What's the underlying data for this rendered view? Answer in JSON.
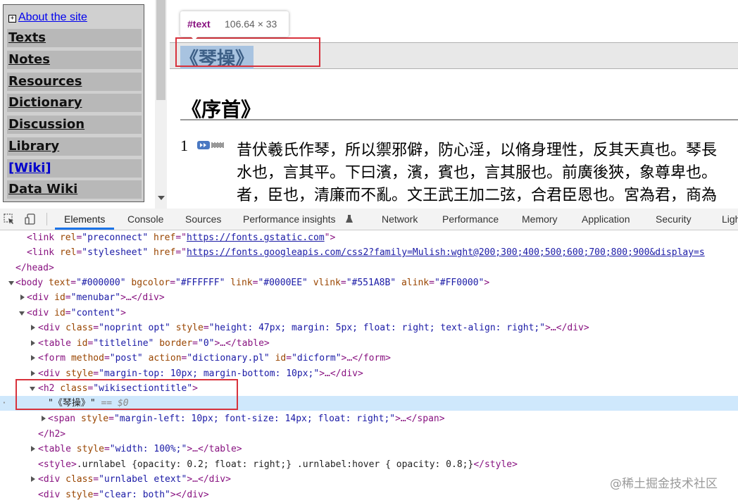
{
  "sidebar": {
    "about_plus": "+",
    "about_link": "About the site",
    "items": [
      "Texts",
      "Notes",
      "Resources",
      "Dictionary",
      "Discussion",
      "Library",
      "[Wiki]",
      "Data Wiki"
    ]
  },
  "tooltip": {
    "tag": "#text",
    "dims": "106.64 × 33"
  },
  "page": {
    "section_title": "《琴操》",
    "preface_heading": "《序首》",
    "verse_number": "1",
    "verse_lines": [
      "昔伏羲氏作琴，所以禦邪僻，防心淫，以脩身理性，反其天真也。琴長",
      "水也，言其平。下曰濱，濱，賓也，言其服也。前廣後狹，象尊卑也。",
      "者，臣也，清廉而不亂。文王武王加二弦，合君臣恩也。宮為君，商為"
    ]
  },
  "devtools": {
    "tabs": [
      "Elements",
      "Console",
      "Sources",
      "Performance insights",
      "Network",
      "Performance",
      "Memory",
      "Application",
      "Security",
      "Ligh"
    ],
    "active_tab": "Elements",
    "dom": {
      "l1": {
        "open": "<link ",
        "a1": "rel",
        "v1": "\"preconnect\"",
        "a2": "href",
        "url": "https://fonts.gstatic.com",
        "close": ">"
      },
      "l2": {
        "open": "<link ",
        "a1": "rel",
        "v1": "\"stylesheet\"",
        "a2": "href",
        "url": "https://fonts.googleapis.com/css2?family=Mulish:wght@200;300;400;500;600;700;800;900&display=s"
      },
      "l3": "</head>",
      "l4": {
        "open": "<body ",
        "a1": "text",
        "v1": "\"#000000\"",
        "a2": "bgcolor",
        "v2": "\"#FFFFFF\"",
        "a3": "link",
        "v3": "\"#0000EE\"",
        "a4": "vlink",
        "v4": "\"#551A8B\"",
        "a5": "alink",
        "v5": "\"#FF0000\"",
        "close": ">"
      },
      "l5": {
        "open": "<div ",
        "a1": "id",
        "v1": "\"menubar\"",
        "mid": ">…",
        "close": "</div>"
      },
      "l6": {
        "open": "<div ",
        "a1": "id",
        "v1": "\"content\"",
        "close": ">"
      },
      "l7": {
        "open": "<div ",
        "a1": "class",
        "v1": "\"noprint opt\"",
        "a2": "style",
        "v2": "\"height: 47px; margin: 5px; float: right; text-align: right;\"",
        "mid": ">…",
        "close": "</div>"
      },
      "l8": {
        "open": "<table ",
        "a1": "id",
        "v1": "\"titleline\"",
        "a2": "border",
        "v2": "\"0\"",
        "mid": ">…",
        "close": "</table>"
      },
      "l9": {
        "open": "<form ",
        "a1": "method",
        "v1": "\"post\"",
        "a2": "action",
        "v2": "\"dictionary.pl\"",
        "a3": "id",
        "v3": "\"dicform\"",
        "mid": ">…",
        "close": "</form>"
      },
      "l10": {
        "open": "<div ",
        "a1": "style",
        "v1": "\"margin-top: 10px; margin-bottom: 10px;\"",
        "mid": ">…",
        "close": "</div>"
      },
      "l11": {
        "open": "<h2 ",
        "a1": "class",
        "v1": "\"wikisectiontitle\"",
        "close": ">"
      },
      "l12": {
        "text": "\"《琴操》\"",
        "eq": " == $0"
      },
      "l13": {
        "open": "<span ",
        "a1": "style",
        "v1": "\"margin-left: 10px; font-size: 14px; float: right;\"",
        "mid": ">…",
        "close": "</span>"
      },
      "l14": "</h2>",
      "l15": {
        "open": "<table ",
        "a1": "style",
        "v1": "\"width: 100%;\"",
        "mid": ">…",
        "close": "</table>"
      },
      "l16": {
        "open": "<style>",
        "css": ".urnlabel {opacity: 0.2; float: right;} .urnlabel:hover { opacity: 0.8;}",
        "close": "</style>"
      },
      "l17": {
        "open": "<div ",
        "a1": "class",
        "v1": "\"urnlabel etext\"",
        "mid": ">…",
        "close": "</div>"
      },
      "l18": {
        "open": "<div ",
        "a1": "style",
        "v1": "\"clear: both\"",
        "mid": ">",
        "close": "</div>"
      }
    }
  },
  "watermark": "@稀土掘金技术社区",
  "colors": {
    "highlight": "#cfe8fc",
    "red_box": "#d8323c",
    "tag": "#881280",
    "attr": "#994500",
    "value": "#1a1aa6"
  }
}
